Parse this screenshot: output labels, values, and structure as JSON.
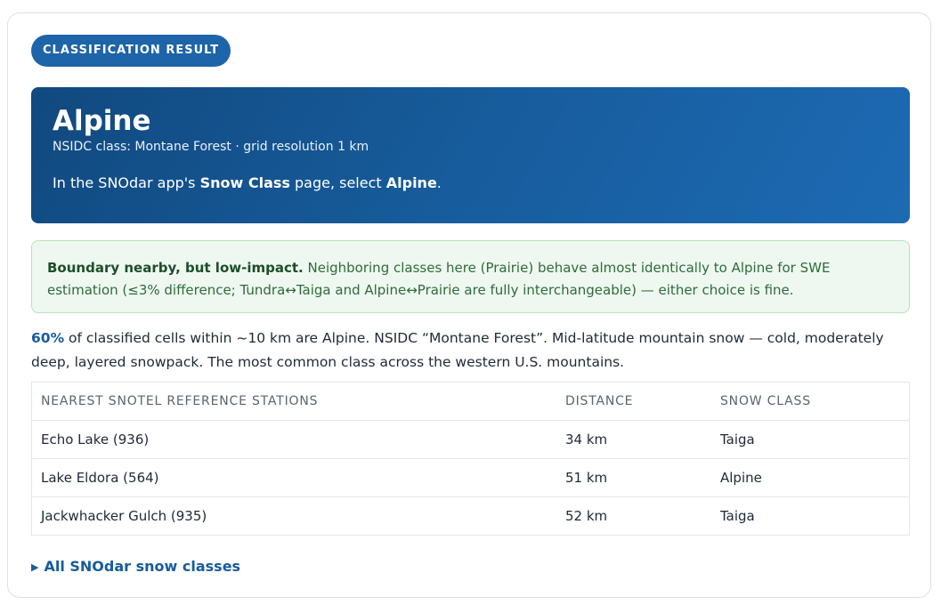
{
  "badge": "CLASSIFICATION RESULT",
  "hero": {
    "title": "Alpine",
    "subtitle": "NSIDC class: Montane Forest · grid resolution 1 km",
    "instruction_pre": "In the SNOdar app's ",
    "instruction_page": "Snow Class",
    "instruction_mid": " page, select ",
    "instruction_choice": "Alpine",
    "instruction_post": "."
  },
  "notice": {
    "heading": "Boundary nearby, but low-impact.",
    "text": " Neighboring classes here (Prairie) behave almost identically to Alpine for SWE estimation (≤3% difference; Tundra↔Taiga and Alpine↔Prairie are fully interchangeable) — either choice is fine."
  },
  "summary": {
    "percent": "60%",
    "text": " of classified cells within ~10 km are Alpine. NSIDC “Montane Forest”. Mid-latitude mountain snow — cold, moderately deep, layered snowpack. The most common class across the western U.S. mountains."
  },
  "table": {
    "headers": [
      "NEAREST SNOTEL REFERENCE STATIONS",
      "DISTANCE",
      "SNOW CLASS"
    ],
    "rows": [
      [
        "Echo Lake (936)",
        "34 km",
        "Taiga"
      ],
      [
        "Lake Eldora (564)",
        "51 km",
        "Alpine"
      ],
      [
        "Jackwhacker Gulch (935)",
        "52 km",
        "Taiga"
      ]
    ]
  },
  "footer": {
    "link_label": "All SNOdar snow classes"
  },
  "colors": {
    "accent": "#1d64a8",
    "hero_dark": "#11497f",
    "notice_bg": "#eef8f0",
    "notice_text": "#2f6b3c"
  }
}
